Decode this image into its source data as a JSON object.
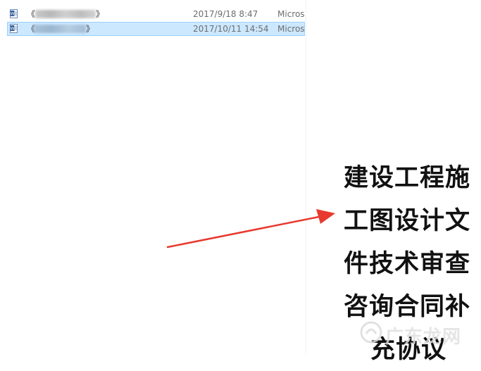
{
  "files": [
    {
      "name_start": "《",
      "name_end": "》",
      "date_modified": "2017/9/18 8:47",
      "type": "Micros",
      "selected": false,
      "icon": "word-document-icon"
    },
    {
      "name_start": "《",
      "name_end": "》",
      "date_modified": "2017/10/11 14:54",
      "type": "Micros",
      "selected": true,
      "icon": "word-document-icon"
    }
  ],
  "caption": {
    "lines": [
      "建设工程施",
      "工图设计文",
      "件技术审查",
      "咨询合同补",
      "充协议"
    ]
  },
  "watermark": {
    "text": "广东龙网",
    "icon": "watermark-logo-icon"
  },
  "colors": {
    "selection_fill": "#cce8ff",
    "selection_border": "#99d1ff",
    "arrow": "#e8392f"
  }
}
